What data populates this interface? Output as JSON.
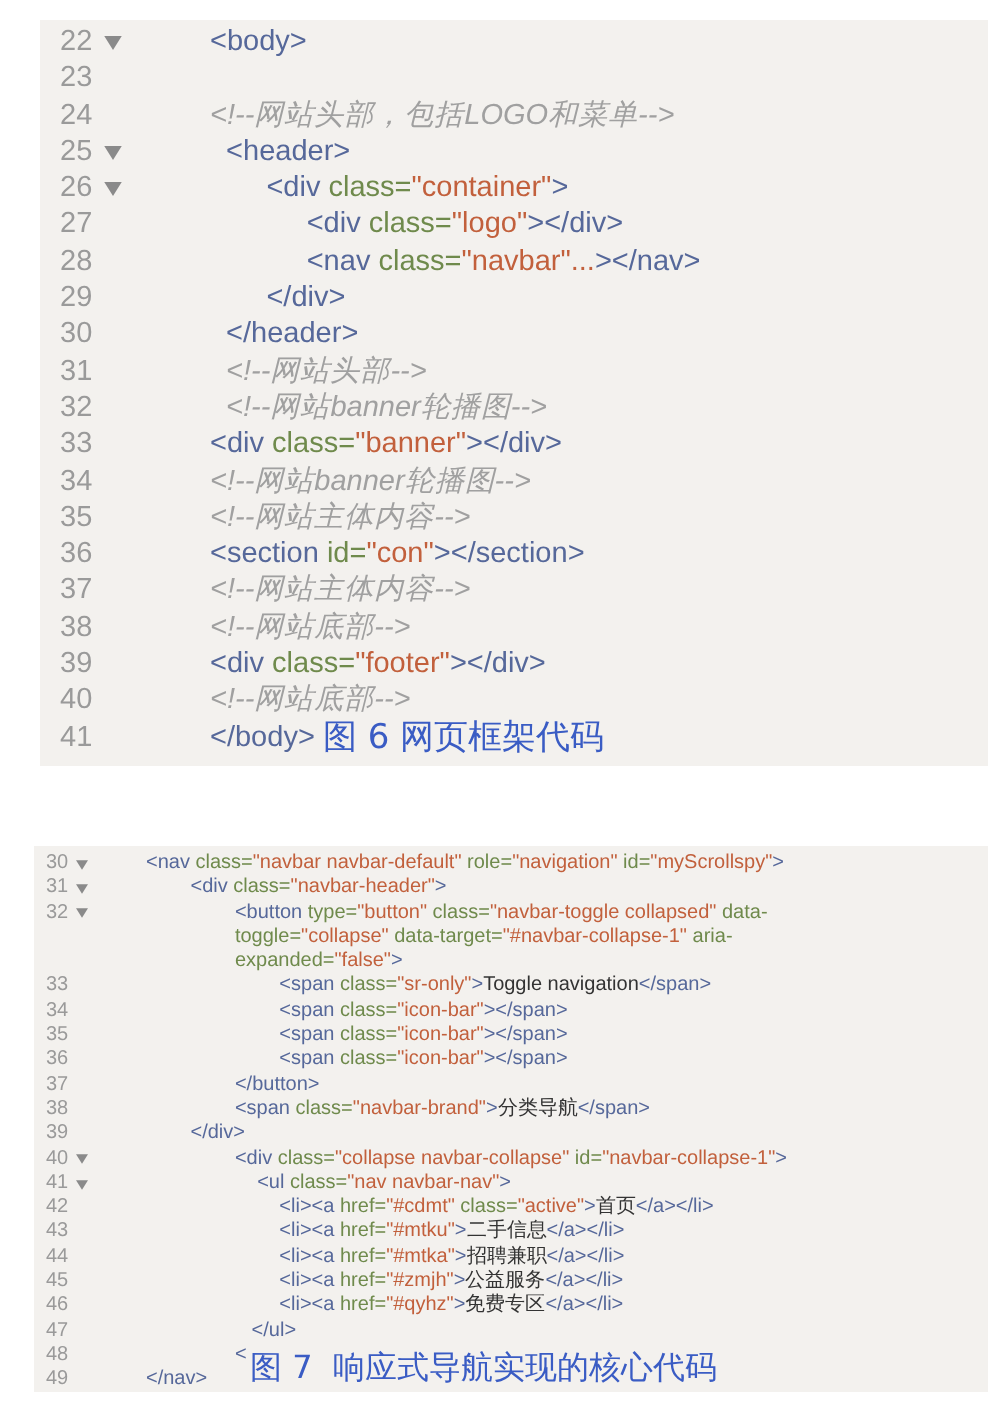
{
  "figures": [
    {
      "caption": "图 6 网页框架代码",
      "lines": [
        {
          "number": "22",
          "foldable": true,
          "tokens": [
            {
              "kind": "tag",
              "text": "<body>"
            }
          ]
        },
        {
          "number": "23",
          "foldable": false
        },
        {
          "number": "24",
          "foldable": false,
          "tokens": [
            {
              "kind": "comment",
              "text": "<!--网站头部，包括LOGO和菜单-->"
            }
          ]
        },
        {
          "number": "25",
          "foldable": true,
          "tokens": [
            {
              "kind": "tag",
              "text": "  <header>"
            }
          ]
        },
        {
          "number": "26",
          "foldable": true,
          "tokens": [
            {
              "kind": "tag",
              "text": "       <div "
            },
            {
              "kind": "attr",
              "text": "class="
            },
            {
              "kind": "string",
              "text": "\"container\""
            },
            {
              "kind": "tag",
              "text": ">"
            }
          ]
        },
        {
          "number": "27",
          "foldable": false,
          "tokens": [
            {
              "kind": "tag",
              "text": "            <div "
            },
            {
              "kind": "attr",
              "text": "class="
            },
            {
              "kind": "string",
              "text": "\"logo\""
            },
            {
              "kind": "tag",
              "text": "></div>"
            }
          ]
        },
        {
          "number": "28",
          "foldable": false,
          "tokens": [
            {
              "kind": "tag",
              "text": "            <nav "
            },
            {
              "kind": "attr",
              "text": "class="
            },
            {
              "kind": "string",
              "text": "\"navbar\"..."
            },
            {
              "kind": "tag",
              "text": "></nav>"
            }
          ]
        },
        {
          "number": "29",
          "foldable": false,
          "tokens": [
            {
              "kind": "tag",
              "text": "       </div>"
            }
          ]
        },
        {
          "number": "30",
          "foldable": false,
          "tokens": [
            {
              "kind": "tag",
              "text": "  </header>"
            }
          ]
        },
        {
          "number": "31",
          "foldable": false,
          "tokens": [
            {
              "kind": "comment",
              "text": "  <!--网站头部-->"
            }
          ]
        },
        {
          "number": "32",
          "foldable": false,
          "tokens": [
            {
              "kind": "comment",
              "text": "  <!--网站banner轮播图-->"
            }
          ]
        },
        {
          "number": "33",
          "foldable": false,
          "tokens": [
            {
              "kind": "tag",
              "text": "<div "
            },
            {
              "kind": "attr",
              "text": "class="
            },
            {
              "kind": "string",
              "text": "\"banner\""
            },
            {
              "kind": "tag",
              "text": "></div>"
            }
          ]
        },
        {
          "number": "34",
          "foldable": false,
          "tokens": [
            {
              "kind": "comment",
              "text": "<!--网站banner轮播图-->"
            }
          ]
        },
        {
          "number": "35",
          "foldable": false,
          "tokens": [
            {
              "kind": "comment",
              "text": "<!--网站主体内容-->"
            }
          ]
        },
        {
          "number": "36",
          "foldable": false,
          "tokens": [
            {
              "kind": "tag",
              "text": "<section "
            },
            {
              "kind": "attr",
              "text": "id="
            },
            {
              "kind": "string",
              "text": "\"con\""
            },
            {
              "kind": "tag",
              "text": "></section>"
            }
          ]
        },
        {
          "number": "37",
          "foldable": false,
          "tokens": [
            {
              "kind": "comment",
              "text": "<!--网站主体内容-->"
            }
          ]
        },
        {
          "number": "38",
          "foldable": false,
          "tokens": [
            {
              "kind": "comment",
              "text": "<!--网站底部-->"
            }
          ]
        },
        {
          "number": "39",
          "foldable": false,
          "tokens": [
            {
              "kind": "tag",
              "text": "<div "
            },
            {
              "kind": "attr",
              "text": "class="
            },
            {
              "kind": "string",
              "text": "\"footer\""
            },
            {
              "kind": "tag",
              "text": "></div>"
            }
          ]
        },
        {
          "number": "40",
          "foldable": false,
          "tokens": [
            {
              "kind": "comment",
              "text": "<!--网站底部-->"
            }
          ]
        },
        {
          "number": "41",
          "foldable": false,
          "tokens": [
            {
              "kind": "tag",
              "text": "</body>"
            }
          ]
        }
      ]
    },
    {
      "caption": "图 7  响应式导航实现的核心代码",
      "lines": [
        {
          "number": "30",
          "foldable": true,
          "tokens": [
            {
              "kind": "tag",
              "text": "<nav "
            },
            {
              "kind": "attr",
              "text": "class="
            },
            {
              "kind": "string",
              "text": "\"navbar navbar-default\""
            },
            {
              "kind": "attr",
              "text": " role="
            },
            {
              "kind": "string",
              "text": "\"navigation\""
            },
            {
              "kind": "attr",
              "text": " id="
            },
            {
              "kind": "string",
              "text": "\"myScrollspy\""
            },
            {
              "kind": "tag",
              "text": ">"
            }
          ]
        },
        {
          "number": "31",
          "foldable": true,
          "tokens": [
            {
              "kind": "tag",
              "text": "        <div "
            },
            {
              "kind": "attr",
              "text": "class="
            },
            {
              "kind": "string",
              "text": "\"navbar-header\""
            },
            {
              "kind": "tag",
              "text": ">"
            }
          ]
        },
        {
          "number": "32",
          "foldable": true,
          "tokens": [
            {
              "kind": "tag",
              "text": "                <button "
            },
            {
              "kind": "attr",
              "text": "type="
            },
            {
              "kind": "string",
              "text": "\"button\""
            },
            {
              "kind": "attr",
              "text": " class="
            },
            {
              "kind": "string",
              "text": "\"navbar-toggle collapsed\""
            },
            {
              "kind": "attr",
              "text": " data-"
            }
          ]
        },
        {
          "foldable": false,
          "tokens": [
            {
              "kind": "attr",
              "text": "                toggle="
            },
            {
              "kind": "string",
              "text": "\"collapse\""
            },
            {
              "kind": "attr",
              "text": " data-target="
            },
            {
              "kind": "string",
              "text": "\"#navbar-collapse-1\""
            },
            {
              "kind": "attr",
              "text": " aria-"
            }
          ]
        },
        {
          "foldable": false,
          "tokens": [
            {
              "kind": "attr",
              "text": "                expanded="
            },
            {
              "kind": "string",
              "text": "\"false\""
            },
            {
              "kind": "tag",
              "text": ">"
            }
          ]
        },
        {
          "number": "33",
          "foldable": false,
          "tokens": [
            {
              "kind": "tag",
              "text": "                        <span "
            },
            {
              "kind": "attr",
              "text": "class="
            },
            {
              "kind": "string",
              "text": "\"sr-only\""
            },
            {
              "kind": "tag",
              "text": ">"
            },
            {
              "kind": "text",
              "text": "Toggle navigation"
            },
            {
              "kind": "tag",
              "text": "</span>"
            }
          ]
        },
        {
          "number": "34",
          "foldable": false,
          "tokens": [
            {
              "kind": "tag",
              "text": "                        <span "
            },
            {
              "kind": "attr",
              "text": "class="
            },
            {
              "kind": "string",
              "text": "\"icon-bar\""
            },
            {
              "kind": "tag",
              "text": "></span>"
            }
          ]
        },
        {
          "number": "35",
          "foldable": false,
          "tokens": [
            {
              "kind": "tag",
              "text": "                        <span "
            },
            {
              "kind": "attr",
              "text": "class="
            },
            {
              "kind": "string",
              "text": "\"icon-bar\""
            },
            {
              "kind": "tag",
              "text": "></span>"
            }
          ]
        },
        {
          "number": "36",
          "foldable": false,
          "tokens": [
            {
              "kind": "tag",
              "text": "                        <span "
            },
            {
              "kind": "attr",
              "text": "class="
            },
            {
              "kind": "string",
              "text": "\"icon-bar\""
            },
            {
              "kind": "tag",
              "text": "></span>"
            }
          ]
        },
        {
          "number": "37",
          "foldable": false,
          "tokens": [
            {
              "kind": "tag",
              "text": "                </button>"
            }
          ]
        },
        {
          "number": "38",
          "foldable": false,
          "tokens": [
            {
              "kind": "tag",
              "text": "                <span "
            },
            {
              "kind": "attr",
              "text": "class="
            },
            {
              "kind": "string",
              "text": "\"navbar-brand\""
            },
            {
              "kind": "tag",
              "text": ">"
            },
            {
              "kind": "text",
              "text": "分类导航"
            },
            {
              "kind": "tag",
              "text": "</span>"
            }
          ]
        },
        {
          "number": "39",
          "foldable": false,
          "tokens": [
            {
              "kind": "tag",
              "text": "        </div>"
            }
          ]
        },
        {
          "number": "40",
          "foldable": true,
          "tokens": [
            {
              "kind": "tag",
              "text": "                <div "
            },
            {
              "kind": "attr",
              "text": "class="
            },
            {
              "kind": "string",
              "text": "\"collapse navbar-collapse\""
            },
            {
              "kind": "attr",
              "text": " id="
            },
            {
              "kind": "string",
              "text": "\"navbar-collapse-1\""
            },
            {
              "kind": "tag",
              "text": ">"
            }
          ]
        },
        {
          "number": "41",
          "foldable": true,
          "tokens": [
            {
              "kind": "tag",
              "text": "                    <ul "
            },
            {
              "kind": "attr",
              "text": "class="
            },
            {
              "kind": "string",
              "text": "\"nav navbar-nav\""
            },
            {
              "kind": "tag",
              "text": ">"
            }
          ]
        },
        {
          "number": "42",
          "foldable": false,
          "tokens": [
            {
              "kind": "tag",
              "text": "                        <li><a "
            },
            {
              "kind": "attr",
              "text": "href="
            },
            {
              "kind": "string",
              "text": "\"#cdmt\""
            },
            {
              "kind": "attr",
              "text": " class="
            },
            {
              "kind": "string",
              "text": "\"active\""
            },
            {
              "kind": "tag",
              "text": ">"
            },
            {
              "kind": "text",
              "text": "首页"
            },
            {
              "kind": "tag",
              "text": "</a></li>"
            }
          ]
        },
        {
          "number": "43",
          "foldable": false,
          "tokens": [
            {
              "kind": "tag",
              "text": "                        <li><a "
            },
            {
              "kind": "attr",
              "text": "href="
            },
            {
              "kind": "string",
              "text": "\"#mtku\""
            },
            {
              "kind": "tag",
              "text": ">"
            },
            {
              "kind": "text",
              "text": "二手信息"
            },
            {
              "kind": "tag",
              "text": "</a></li>"
            }
          ]
        },
        {
          "number": "44",
          "foldable": false,
          "tokens": [
            {
              "kind": "tag",
              "text": "                        <li><a "
            },
            {
              "kind": "attr",
              "text": "href="
            },
            {
              "kind": "string",
              "text": "\"#mtka\""
            },
            {
              "kind": "tag",
              "text": ">"
            },
            {
              "kind": "text",
              "text": "招聘兼职"
            },
            {
              "kind": "tag",
              "text": "</a></li>"
            }
          ]
        },
        {
          "number": "45",
          "foldable": false,
          "tokens": [
            {
              "kind": "tag",
              "text": "                        <li><a "
            },
            {
              "kind": "attr",
              "text": "href="
            },
            {
              "kind": "string",
              "text": "\"#zmjh\""
            },
            {
              "kind": "tag",
              "text": ">"
            },
            {
              "kind": "text",
              "text": "公益服务"
            },
            {
              "kind": "tag",
              "text": "</a></li>"
            }
          ]
        },
        {
          "number": "46",
          "foldable": false,
          "tokens": [
            {
              "kind": "tag",
              "text": "                        <li><a "
            },
            {
              "kind": "attr",
              "text": "href="
            },
            {
              "kind": "string",
              "text": "\"#qyhz\""
            },
            {
              "kind": "tag",
              "text": ">"
            },
            {
              "kind": "text",
              "text": "免费专区"
            },
            {
              "kind": "tag",
              "text": "</a></li>"
            }
          ]
        },
        {
          "number": "47",
          "foldable": false,
          "tokens": [
            {
              "kind": "tag",
              "text": "                   </ul>"
            }
          ]
        },
        {
          "number": "48",
          "foldable": false,
          "tokens": [
            {
              "kind": "tag",
              "text": "                <"
            }
          ]
        },
        {
          "number": "49",
          "foldable": false,
          "tokens": [
            {
              "kind": "tag",
              "text": "</nav>"
            }
          ]
        }
      ]
    }
  ]
}
